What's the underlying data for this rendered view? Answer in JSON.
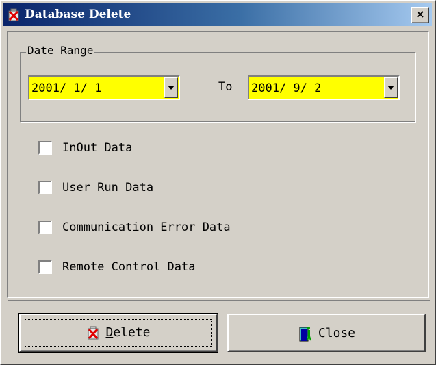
{
  "window": {
    "title": "Database Delete",
    "close_glyph": "×"
  },
  "date_range": {
    "legend": "Date Range",
    "from_value": "2001/ 1/ 1",
    "to_label": "To",
    "to_value": "2001/ 9/ 2",
    "field_color": "#ffff00"
  },
  "options": [
    {
      "label": "InOut Data",
      "checked": false
    },
    {
      "label": "User Run Data",
      "checked": false
    },
    {
      "label": "Communication Error Data",
      "checked": false
    },
    {
      "label": "Remote Control Data",
      "checked": false
    }
  ],
  "buttons": {
    "delete_accel": "D",
    "delete_rest": "elete",
    "delete_icon": "delete-icon",
    "close_accel": "C",
    "close_rest": "lose",
    "close_icon": "door-exit-icon"
  }
}
